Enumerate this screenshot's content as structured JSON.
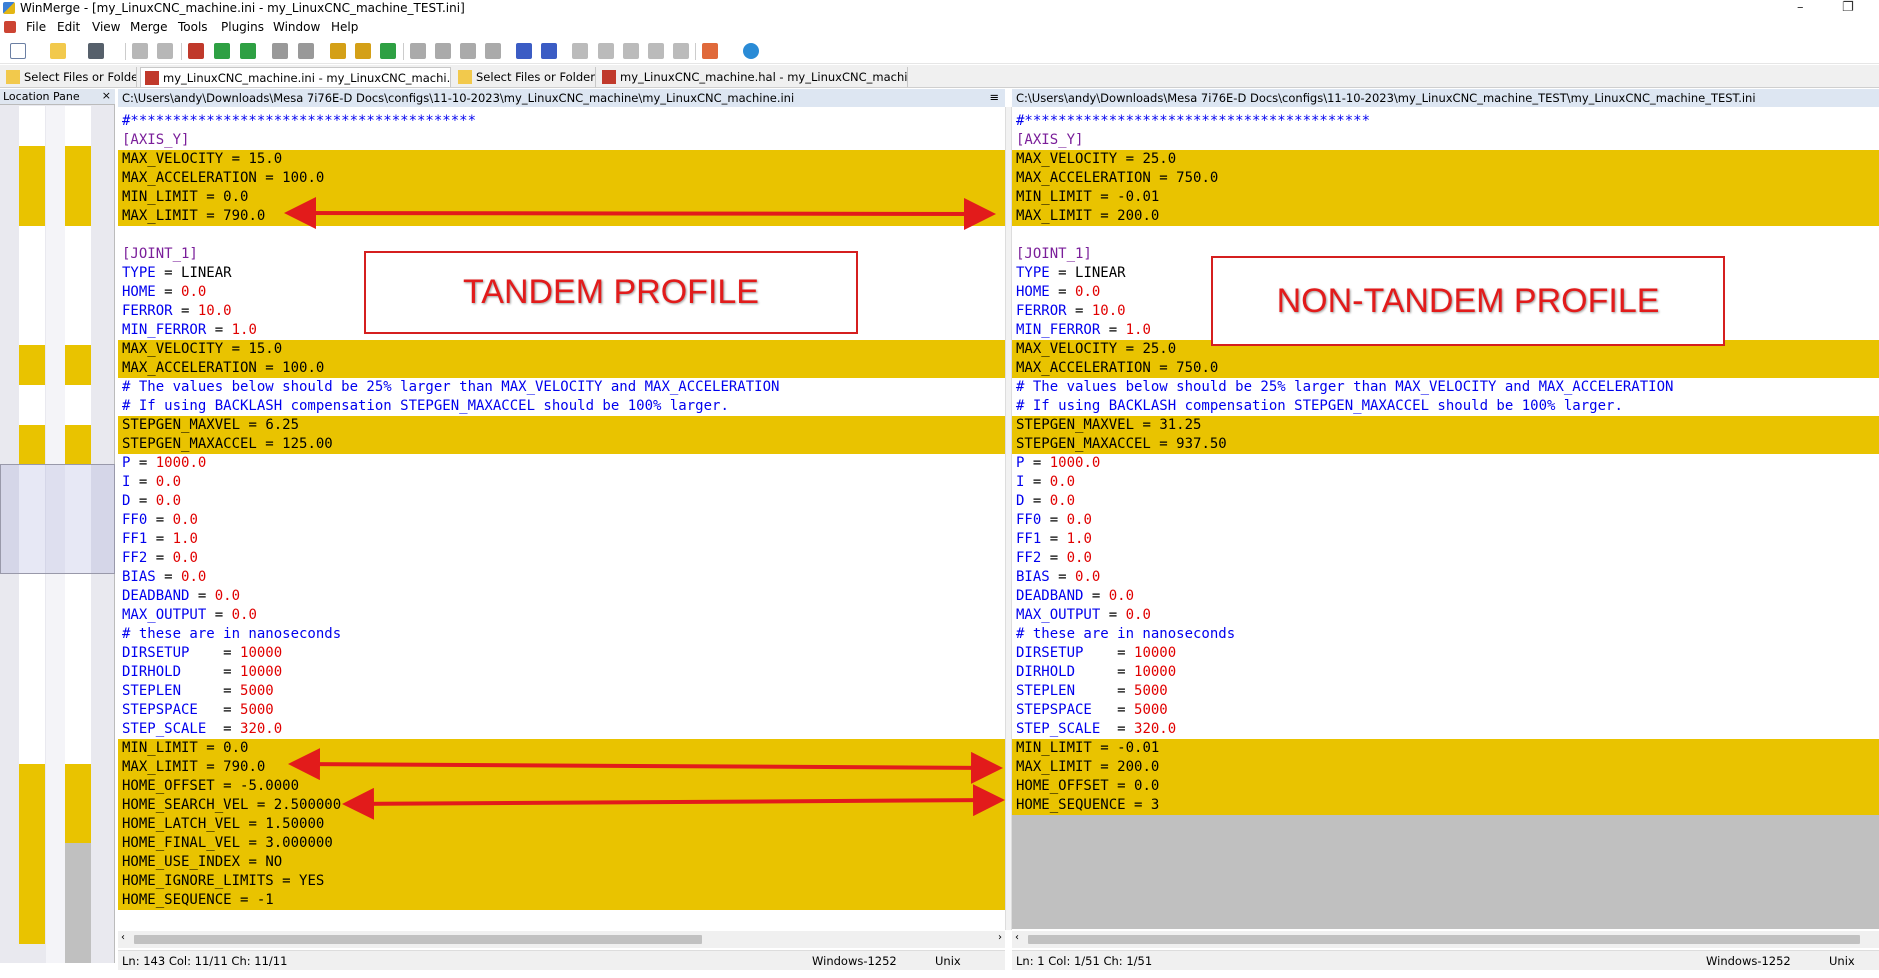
{
  "window": {
    "title": "WinMerge - [my_LinuxCNC_machine.ini - my_LinuxCNC_machine_TEST.ini]",
    "controls": [
      "–",
      "❐"
    ]
  },
  "menu": [
    "File",
    "Edit",
    "View",
    "Merge",
    "Tools",
    "Plugins",
    "Window",
    "Help"
  ],
  "tabs": [
    {
      "label": "Select Files or Folders",
      "icon": "folder-compare-icon"
    },
    {
      "label": "my_LinuxCNC_machine.ini - my_LinuxCNC_machi...",
      "icon": "file-compare-icon",
      "active": true
    },
    {
      "label": "Select Files or Folders",
      "icon": "folder-compare-icon"
    },
    {
      "label": "my_LinuxCNC_machine.hal - my_LinuxCNC_machi...",
      "icon": "file-compare-icon"
    }
  ],
  "location_pane": {
    "title": "Location Pane",
    "close": "×"
  },
  "left": {
    "path": "C:\\Users\\andy\\Downloads\\Mesa 7i76E-D Docs\\configs\\11-10-2023\\my_LinuxCNC_machine\\my_LinuxCNC_machine.ini",
    "menu_glyph": "≡",
    "status": {
      "pos": "Ln: 143  Col: 11/11  Ch: 11/11",
      "encoding": "Windows-1252",
      "eol": "Unix"
    }
  },
  "right": {
    "path": "C:\\Users\\andy\\Downloads\\Mesa 7i76E-D Docs\\configs\\11-10-2023\\my_LinuxCNC_machine_TEST\\my_LinuxCNC_machine_TEST.ini",
    "status": {
      "pos": "Ln: 1  Col: 1/51  Ch: 1/51",
      "encoding": "Windows-1252",
      "eol": "Unix"
    }
  },
  "left_lines": [
    {
      "t": "cmt",
      "text": "#*****************************************"
    },
    {
      "t": "sec",
      "text": "[AXIS_Y]"
    },
    {
      "t": "kv",
      "k": "MAX_VELOCITY",
      "v": "15.0",
      "d": 1
    },
    {
      "t": "kv",
      "k": "MAX_ACCELERATION",
      "v": "100.0",
      "d": 1
    },
    {
      "t": "kv",
      "k": "MIN_LIMIT",
      "v": "0.0",
      "d": 1
    },
    {
      "t": "kv",
      "k": "MAX_LIMIT",
      "v": "790.0",
      "d": 1
    },
    {
      "t": "blank"
    },
    {
      "t": "sec",
      "text": "[JOINT_1]"
    },
    {
      "t": "kv",
      "k": "TYPE",
      "v": "LINEAR",
      "plainv": 1
    },
    {
      "t": "kv",
      "k": "HOME",
      "v": "0.0"
    },
    {
      "t": "kv",
      "k": "FERROR",
      "v": "10.0"
    },
    {
      "t": "kv",
      "k": "MIN_FERROR",
      "v": "1.0"
    },
    {
      "t": "kv",
      "k": "MAX_VELOCITY",
      "v": "15.0",
      "d": 1
    },
    {
      "t": "kv",
      "k": "MAX_ACCELERATION",
      "v": "100.0",
      "d": 1
    },
    {
      "t": "cmt",
      "text": "# The values below should be 25% larger than MAX_VELOCITY and MAX_ACCELERATION"
    },
    {
      "t": "cmt",
      "text": "# If using BACKLASH compensation STEPGEN_MAXACCEL should be 100% larger."
    },
    {
      "t": "kv",
      "k": "STEPGEN_MAXVEL",
      "v": "6.25",
      "d": 1
    },
    {
      "t": "kv",
      "k": "STEPGEN_MAXACCEL",
      "v": "125.00",
      "d": 1
    },
    {
      "t": "kv",
      "k": "P",
      "v": "1000.0"
    },
    {
      "t": "kv",
      "k": "I",
      "v": "0.0"
    },
    {
      "t": "kv",
      "k": "D",
      "v": "0.0"
    },
    {
      "t": "kv",
      "k": "FF0",
      "v": "0.0"
    },
    {
      "t": "kv",
      "k": "FF1",
      "v": "1.0"
    },
    {
      "t": "kv",
      "k": "FF2",
      "v": "0.0"
    },
    {
      "t": "kv",
      "k": "BIAS",
      "v": "0.0"
    },
    {
      "t": "kv",
      "k": "DEADBAND",
      "v": "0.0"
    },
    {
      "t": "kv",
      "k": "MAX_OUTPUT",
      "v": "0.0"
    },
    {
      "t": "cmt",
      "text": "# these are in nanoseconds"
    },
    {
      "t": "kv",
      "k": "DIRSETUP   ",
      "v": "10000"
    },
    {
      "t": "kv",
      "k": "DIRHOLD    ",
      "v": "10000"
    },
    {
      "t": "kv",
      "k": "STEPLEN    ",
      "v": "5000"
    },
    {
      "t": "kv",
      "k": "STEPSPACE  ",
      "v": "5000"
    },
    {
      "t": "kv",
      "k": "STEP_SCALE ",
      "v": "320.0"
    },
    {
      "t": "kv",
      "k": "MIN_LIMIT",
      "v": "0.0",
      "d": 1
    },
    {
      "t": "kv",
      "k": "MAX_LIMIT",
      "v": "790.0",
      "d": 1
    },
    {
      "t": "kv",
      "k": "HOME_OFFSET",
      "v": "-5.0000",
      "d": 1
    },
    {
      "t": "kv",
      "k": "HOME_SEARCH_VEL",
      "v": "2.500000",
      "d": 1
    },
    {
      "t": "kv",
      "k": "HOME_LATCH_VEL",
      "v": "1.50000",
      "d": 1
    },
    {
      "t": "kv",
      "k": "HOME_FINAL_VEL",
      "v": "3.000000",
      "d": 1
    },
    {
      "t": "kv",
      "k": "HOME_USE_INDEX",
      "v": "NO",
      "d": 1
    },
    {
      "t": "kv",
      "k": "HOME_IGNORE_LIMITS",
      "v": "YES",
      "d": 1
    },
    {
      "t": "kv",
      "k": "HOME_SEQUENCE",
      "v": "-1",
      "d": 1
    }
  ],
  "right_lines": [
    {
      "t": "cmt",
      "text": "#*****************************************"
    },
    {
      "t": "sec",
      "text": "[AXIS_Y]"
    },
    {
      "t": "kv",
      "k": "MAX_VELOCITY",
      "v": "25.0",
      "d": 1
    },
    {
      "t": "kv",
      "k": "MAX_ACCELERATION",
      "v": "750.0",
      "d": 1
    },
    {
      "t": "kv",
      "k": "MIN_LIMIT",
      "v": "-0.01",
      "d": 1
    },
    {
      "t": "kv",
      "k": "MAX_LIMIT",
      "v": "200.0",
      "d": 1
    },
    {
      "t": "blank"
    },
    {
      "t": "sec",
      "text": "[JOINT_1]"
    },
    {
      "t": "kv",
      "k": "TYPE",
      "v": "LINEAR",
      "plainv": 1
    },
    {
      "t": "kv",
      "k": "HOME",
      "v": "0.0"
    },
    {
      "t": "kv",
      "k": "FERROR",
      "v": "10.0"
    },
    {
      "t": "kv",
      "k": "MIN_FERROR",
      "v": "1.0"
    },
    {
      "t": "kv",
      "k": "MAX_VELOCITY",
      "v": "25.0",
      "d": 1
    },
    {
      "t": "kv",
      "k": "MAX_ACCELERATION",
      "v": "750.0",
      "d": 1
    },
    {
      "t": "cmt",
      "text": "# The values below should be 25% larger than MAX_VELOCITY and MAX_ACCELERATION"
    },
    {
      "t": "cmt",
      "text": "# If using BACKLASH compensation STEPGEN_MAXACCEL should be 100% larger."
    },
    {
      "t": "kv",
      "k": "STEPGEN_MAXVEL",
      "v": "31.25",
      "d": 1
    },
    {
      "t": "kv",
      "k": "STEPGEN_MAXACCEL",
      "v": "937.50",
      "d": 1
    },
    {
      "t": "kv",
      "k": "P",
      "v": "1000.0"
    },
    {
      "t": "kv",
      "k": "I",
      "v": "0.0"
    },
    {
      "t": "kv",
      "k": "D",
      "v": "0.0"
    },
    {
      "t": "kv",
      "k": "FF0",
      "v": "0.0"
    },
    {
      "t": "kv",
      "k": "FF1",
      "v": "1.0"
    },
    {
      "t": "kv",
      "k": "FF2",
      "v": "0.0"
    },
    {
      "t": "kv",
      "k": "BIAS",
      "v": "0.0"
    },
    {
      "t": "kv",
      "k": "DEADBAND",
      "v": "0.0"
    },
    {
      "t": "kv",
      "k": "MAX_OUTPUT",
      "v": "0.0"
    },
    {
      "t": "cmt",
      "text": "# these are in nanoseconds"
    },
    {
      "t": "kv",
      "k": "DIRSETUP   ",
      "v": "10000"
    },
    {
      "t": "kv",
      "k": "DIRHOLD    ",
      "v": "10000"
    },
    {
      "t": "kv",
      "k": "STEPLEN    ",
      "v": "5000"
    },
    {
      "t": "kv",
      "k": "STEPSPACE  ",
      "v": "5000"
    },
    {
      "t": "kv",
      "k": "STEP_SCALE ",
      "v": "320.0"
    },
    {
      "t": "kv",
      "k": "MIN_LIMIT",
      "v": "-0.01",
      "d": 1
    },
    {
      "t": "kv",
      "k": "MAX_LIMIT",
      "v": "200.0",
      "d": 1
    },
    {
      "t": "kv",
      "k": "HOME_OFFSET",
      "v": "0.0",
      "d": 1
    },
    {
      "t": "kv",
      "k": "HOME_SEQUENCE",
      "v": "3",
      "d": 1
    },
    {
      "t": "pad"
    },
    {
      "t": "pad"
    },
    {
      "t": "pad"
    },
    {
      "t": "pad"
    },
    {
      "t": "pad"
    },
    {
      "t": "pad"
    }
  ],
  "annotations": {
    "left_label": "TANDEM PROFILE",
    "right_label": "NON-TANDEM PROFILE",
    "arrow_color": "#e21b1b"
  },
  "colors": {
    "diff": "#e9c300",
    "key": "#0000ee",
    "value": "#e00000",
    "section": "#7a1e9a"
  }
}
